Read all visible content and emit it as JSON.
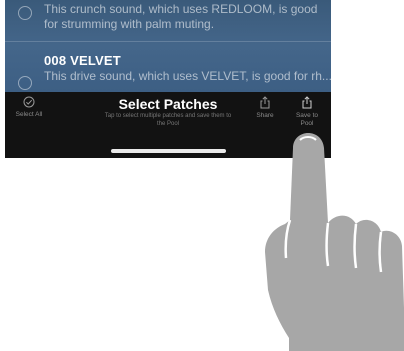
{
  "patches": [
    {
      "name": "",
      "description": "This crunch sound, which uses REDLOOM, is good for strumming with palm muting."
    },
    {
      "name": "008 VELVET",
      "description": "This drive sound, which uses VELVET, is good for rh..."
    }
  ],
  "toolbar": {
    "select_all_label": "Select All",
    "title": "Select Patches",
    "subtitle": "Tap to select multiple patches and save them to the Pool",
    "share_label": "Share",
    "save_to_pool_label": "Save to Pool"
  },
  "icons": {
    "select_all": "check-circle-icon",
    "share": "share-icon",
    "save_to_pool": "share-icon"
  },
  "colors": {
    "list_background": "#3e6085",
    "toolbar_background": "#121212",
    "hand": "#a7a7a7"
  }
}
